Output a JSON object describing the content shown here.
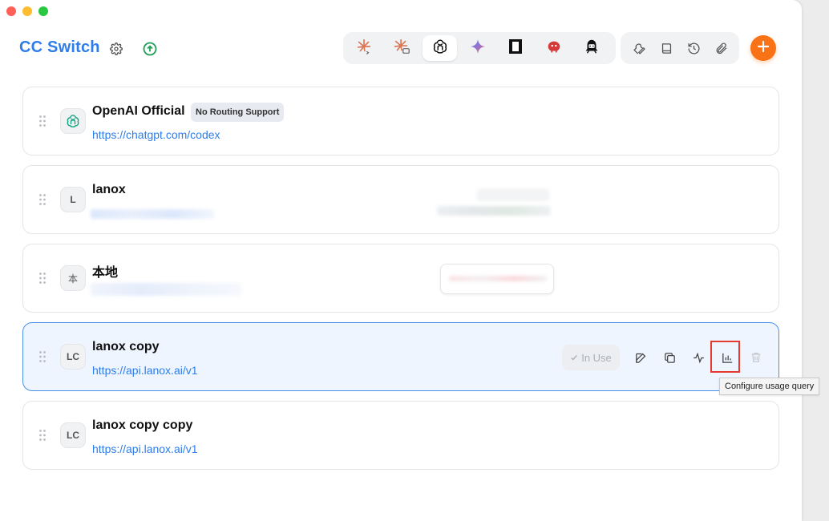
{
  "app": {
    "title": "CC Switch",
    "settings_icon": "gear-icon",
    "update_icon": "arrow-up-circle-icon"
  },
  "app_tabs": [
    {
      "name": "claude-code",
      "icon": "claude-terminal-icon",
      "active": false
    },
    {
      "name": "claude-desktop",
      "icon": "claude-desktop-icon",
      "active": false
    },
    {
      "name": "codex",
      "icon": "openai-icon",
      "active": true
    },
    {
      "name": "gemini",
      "icon": "gemini-icon",
      "active": false
    },
    {
      "name": "app-5",
      "icon": "square-app-icon",
      "active": false
    },
    {
      "name": "app-6",
      "icon": "red-creature-icon",
      "active": false
    },
    {
      "name": "app-7",
      "icon": "black-character-icon",
      "active": false
    }
  ],
  "tools": [
    {
      "name": "wrench-icon"
    },
    {
      "name": "book-icon"
    },
    {
      "name": "history-icon"
    },
    {
      "name": "paperclip-icon"
    }
  ],
  "add_button_icon": "plus-icon",
  "colors": {
    "accent": "#2e7de9",
    "add": "#f97316",
    "active_card_bg": "#eef5ff",
    "active_card_border": "#4a8fe6",
    "highlight": "#e53a2f"
  },
  "providers": [
    {
      "name": "OpenAI Official",
      "badge": "No Routing Support",
      "url": "https://chatgpt.com/codex",
      "avatar": "openai-icon",
      "active": false
    },
    {
      "name": "lanox",
      "avatar_text": "L",
      "url": "",
      "active": false
    },
    {
      "name": "本地",
      "avatar_text": "本",
      "url": "",
      "active": false
    },
    {
      "name": "lanox copy",
      "avatar_text": "LC",
      "url": "https://api.lanox.ai/v1",
      "active": true
    },
    {
      "name": "lanox copy copy",
      "avatar_text": "LC",
      "url": "https://api.lanox.ai/v1",
      "active": false
    }
  ],
  "active_actions": {
    "in_use_label": "In Use",
    "buttons": [
      "edit-icon",
      "duplicate-icon",
      "activity-icon",
      "usage-chart-icon",
      "trash-icon"
    ]
  },
  "tooltip": "Configure usage query"
}
